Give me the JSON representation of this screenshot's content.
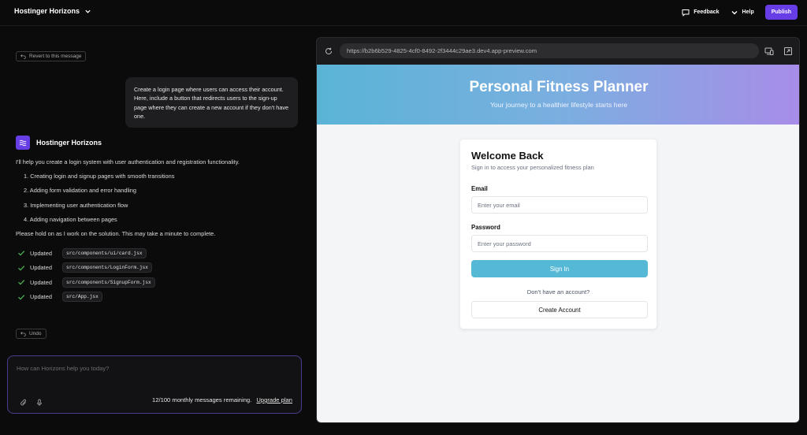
{
  "app": {
    "title": "Hostinger Horizons"
  },
  "header": {
    "feedback_label": "Feedback",
    "help_label": "Help",
    "publish_label": "Publish"
  },
  "chat": {
    "revert_label": "Revert to this message",
    "user_message": "Create a login page where users can access their account. Here, include a button that redirects users to the sign-up page where they can create a new account if they don't have one.",
    "assistant_name": "Hostinger Horizons",
    "assistant_intro": "I'll help you create a login system with user authentication and registration functionality.",
    "steps": [
      "1. Creating login and signup pages with smooth transitions",
      "2. Adding form validation and error handling",
      "3. Implementing user authentication flow",
      "4. Adding navigation between pages"
    ],
    "assistant_outro": "Please hold on as I work on the solution. This may take a minute to complete.",
    "updates": [
      {
        "label": "Updated",
        "file": "src/components/ui/card.jsx"
      },
      {
        "label": "Updated",
        "file": "src/components/LoginForm.jsx"
      },
      {
        "label": "Updated",
        "file": "src/components/SignupForm.jsx"
      },
      {
        "label": "Updated",
        "file": "src/App.jsx"
      }
    ],
    "undo_label": "Undo"
  },
  "composer": {
    "placeholder": "How can Horizons help you today?",
    "remaining_text": "12/100 monthly messages remaining.",
    "upgrade_label": "Upgrade plan"
  },
  "preview": {
    "url": "https://b2b6b529-4825-4cf0-8492-2f3444c29ae3.dev4.app-preview.com",
    "site": {
      "hero_title": "Personal Fitness Planner",
      "hero_subtitle": "Your journey to a healthier lifestyle starts here",
      "card_title": "Welcome Back",
      "card_subtitle": "Sign in to access your personalized fitness plan",
      "email_label": "Email",
      "email_placeholder": "Enter your email",
      "password_label": "Password",
      "password_placeholder": "Enter your password",
      "signin_label": "Sign In",
      "no_account_text": "Don't have an account?",
      "create_label": "Create Account"
    }
  },
  "colors": {
    "accent": "#673de6",
    "check": "#4caf50",
    "signin": "#55b9d6"
  }
}
